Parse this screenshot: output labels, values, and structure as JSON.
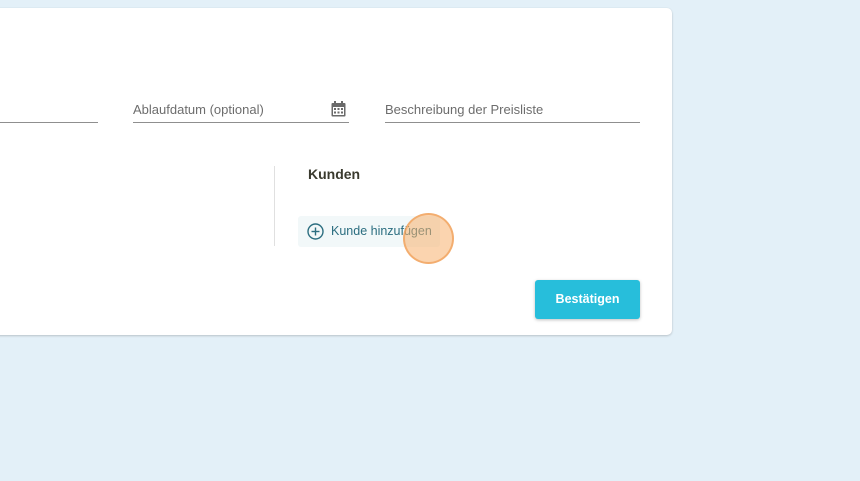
{
  "form": {
    "expiry_date_label": "Ablaufdatum (optional)",
    "description_label": "Beschreibung der Preisliste"
  },
  "customers": {
    "title": "Kunden",
    "add_label": "Kunde hinzufügen"
  },
  "actions": {
    "confirm_label": "Bestätigen"
  },
  "colors": {
    "background": "#e3f0f8",
    "accent": "#27bedb",
    "add_text": "#2c6e80"
  }
}
